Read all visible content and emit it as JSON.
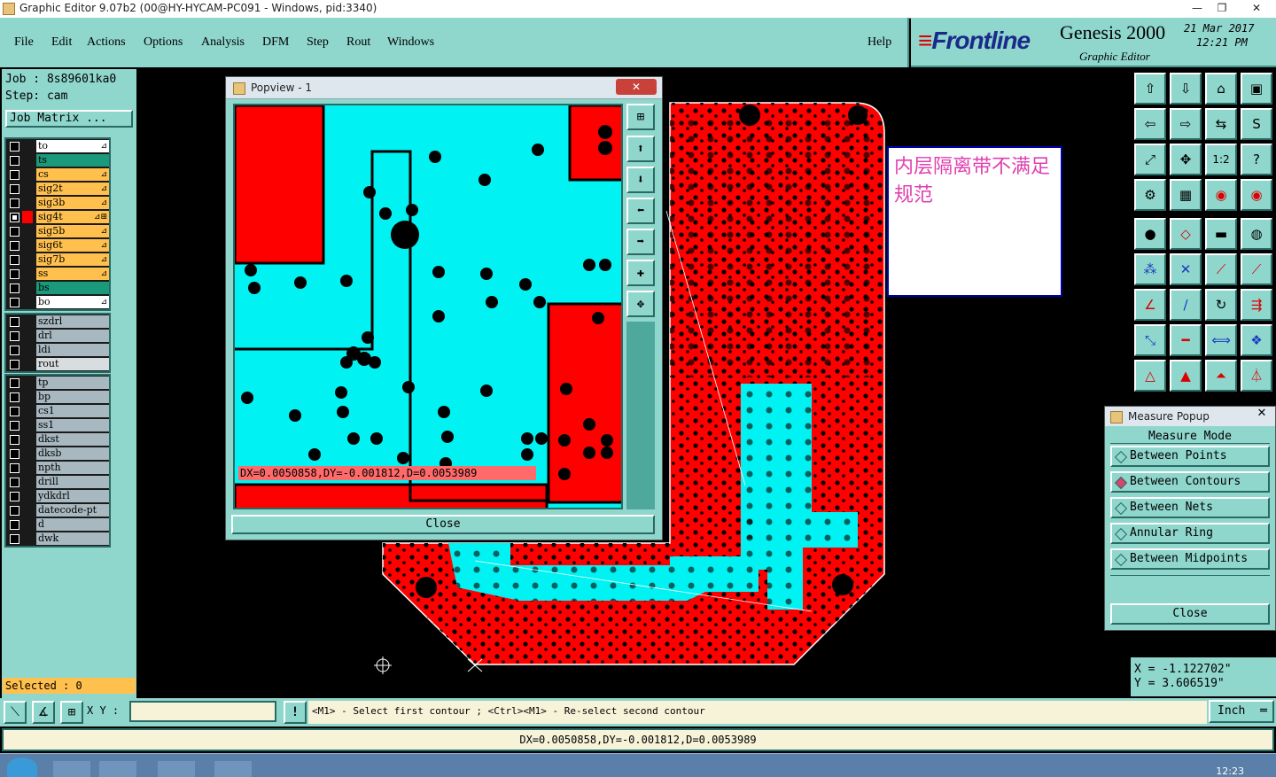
{
  "window": {
    "title": "Graphic Editor 9.07b2 (00@HY-HYCAM-PC091 - Windows, pid:3340)",
    "minimize": "—",
    "restore": "❐",
    "close": "✕"
  },
  "menu": {
    "items": [
      "File",
      "Edit",
      "Actions",
      "Options",
      "Analysis",
      "DFM",
      "Step",
      "Rout",
      "Windows"
    ],
    "help": "Help"
  },
  "brand": {
    "logo": "Frontline",
    "product": "Genesis 2000",
    "subtitle": "Graphic Editor",
    "date": "21 Mar 2017",
    "time": "12:21 PM"
  },
  "job": {
    "job_line": "Job : 8s89601ka0",
    "step_line": "Step: cam",
    "matrix_button": "Job Matrix ..."
  },
  "layers_board": [
    {
      "name": "to",
      "color": "#ffffff",
      "tag": "⊿",
      "checked": false
    },
    {
      "name": "ts",
      "color": "#1a9a7a",
      "tag": "",
      "checked": false
    },
    {
      "name": "cs",
      "color": "#ffc04d",
      "tag": "⊿",
      "checked": false
    },
    {
      "name": "sig2t",
      "color": "#ffc04d",
      "tag": "⊿",
      "checked": false
    },
    {
      "name": "sig3b",
      "color": "#ffc04d",
      "tag": "⊿",
      "checked": false
    },
    {
      "name": "sig4t",
      "color": "#ffc04d",
      "tag": "⊿⊞",
      "checked": true
    },
    {
      "name": "sig5b",
      "color": "#ffc04d",
      "tag": "⊿",
      "checked": false
    },
    {
      "name": "sig6t",
      "color": "#ffc04d",
      "tag": "⊿",
      "checked": false
    },
    {
      "name": "sig7b",
      "color": "#ffc04d",
      "tag": "⊿",
      "checked": false
    },
    {
      "name": "ss",
      "color": "#ffc04d",
      "tag": "⊿",
      "checked": false
    },
    {
      "name": "bs",
      "color": "#1a9a7a",
      "tag": "",
      "checked": false
    },
    {
      "name": "bo",
      "color": "#ffffff",
      "tag": "⊿",
      "checked": false
    }
  ],
  "layers_drill": [
    {
      "name": "szdrl",
      "color": "#a8b8c0"
    },
    {
      "name": "drl",
      "color": "#a8b8c0"
    },
    {
      "name": "ldi",
      "color": "#a8b8c0"
    },
    {
      "name": "rout",
      "color": "#d8dde0"
    }
  ],
  "layers_misc": [
    {
      "name": "tp",
      "color": "#a8b8c0"
    },
    {
      "name": "bp",
      "color": "#a8b8c0"
    },
    {
      "name": "cs1",
      "color": "#a8b8c0"
    },
    {
      "name": "ss1",
      "color": "#a8b8c0"
    },
    {
      "name": "dkst",
      "color": "#a8b8c0"
    },
    {
      "name": "dksb",
      "color": "#a8b8c0"
    },
    {
      "name": "npth",
      "color": "#a8b8c0"
    },
    {
      "name": "drill",
      "color": "#a8b8c0"
    },
    {
      "name": "ydkdrl",
      "color": "#a8b8c0"
    },
    {
      "name": "datecode-pt",
      "color": "#a8b8c0"
    },
    {
      "name": "d",
      "color": "#a8b8c0"
    },
    {
      "name": "dwk",
      "color": "#a8b8c0"
    }
  ],
  "selected": "Selected : 0",
  "popview": {
    "title": "Popview - 1",
    "close_x": "✕",
    "measurement": "DX=0.0050858,DY=-0.001812,D=0.0053989",
    "close_button": "Close"
  },
  "annotation": {
    "text": "内层隔离带不满足规范"
  },
  "measure_popup": {
    "title": "Measure Popup",
    "close_x": "✕",
    "header": "Measure Mode",
    "options": [
      "Between Points",
      "Between Contours",
      "Between Nets",
      "Annular Ring",
      "Between Midpoints"
    ],
    "selected_index": 1,
    "close_button": "Close"
  },
  "coords": {
    "x": "X  = -1.122702\"",
    "y": "Y  = 3.606519\""
  },
  "command": {
    "xy_label": "X Y :",
    "xy_value": "",
    "warn": "!",
    "prompt": "<M1> - Select first contour ; <Ctrl><M1> - Re-select second contour",
    "units": "Inch"
  },
  "status": "DX=0.0050858,DY=-0.001812,D=0.0053989",
  "taskbar": {
    "clock": "12:23"
  },
  "colors": {
    "panel": "#8fd6cc",
    "copper": "#ff0000",
    "isolation": "#00f2f2",
    "annotation_text": "#e040b0"
  }
}
